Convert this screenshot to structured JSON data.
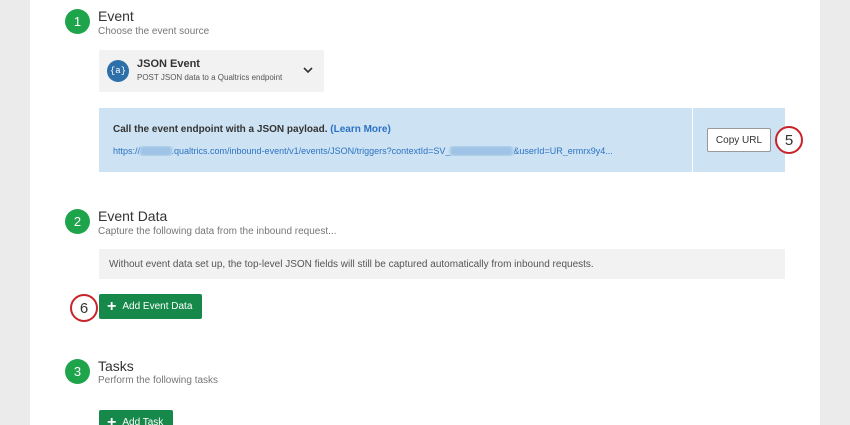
{
  "steps": [
    {
      "number": "1",
      "title": "Event",
      "subtitle": "Choose the event source"
    },
    {
      "number": "2",
      "title": "Event Data",
      "subtitle": "Capture the following data from the inbound request..."
    },
    {
      "number": "3",
      "title": "Tasks",
      "subtitle": "Perform the following tasks"
    }
  ],
  "event_source": {
    "icon_text": "{a}",
    "icon_name": "json-braces-icon",
    "title": "JSON Event",
    "subtitle": "POST JSON data to a Qualtrics endpoint"
  },
  "endpoint": {
    "intro": "Call the event endpoint with a JSON payload.",
    "learn_more": "(Learn More)",
    "url_prefix": "https://",
    "url_blur_1": "xxxxxxx",
    "url_middle": ".qualtrics.com/inbound-event/v1/events/JSON/triggers?contextId=SV_",
    "url_blur_2": "xxxxxxxxxxxxxx",
    "url_suffix": "&userId=UR_ermrx9y4..."
  },
  "copy_url_label": "Copy URL",
  "event_data_notice": "Without event data set up, the top-level JSON fields will still be captured automatically from inbound requests.",
  "add_event_data_label": "Add Event Data",
  "add_task_label": "Add Task",
  "callouts": {
    "copy": "5",
    "add_event_data": "6"
  },
  "colors": {
    "step_green": "#1ea44a",
    "button_green": "#16894a",
    "info_blue": "#cde2f2",
    "link_blue": "#2b73c6",
    "callout_red": "#c8232b"
  }
}
